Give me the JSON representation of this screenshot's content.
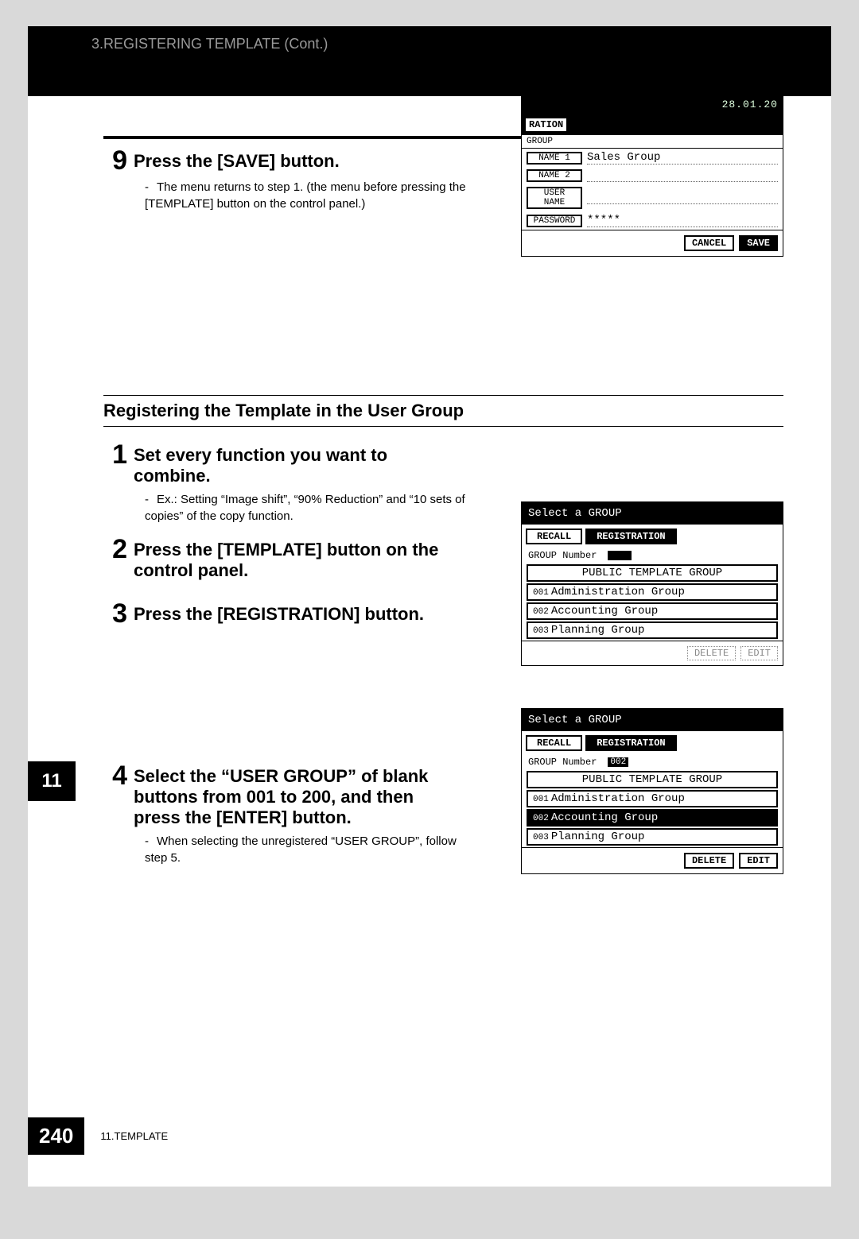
{
  "header": "3.REGISTERING TEMPLATE (Cont.)",
  "step9": {
    "num": "9",
    "title": "Press the [SAVE] button.",
    "bullet": "The menu returns to step 1. (the menu before pressing the [TEMPLATE] button on the control panel.)"
  },
  "panel1": {
    "date": "28.01.20",
    "tab": "RATION",
    "group_lbl": "GROUP",
    "fields": {
      "name1_lbl": "NAME 1",
      "name1_val": "Sales Group",
      "name2_lbl": "NAME 2",
      "name2_val": "",
      "user_lbl": "USER NAME",
      "user_val": "",
      "pass_lbl": "PASSWORD",
      "pass_val": "*****"
    },
    "cancel": "CANCEL",
    "save": "SAVE"
  },
  "section": "Registering the Template in the User Group",
  "step1": {
    "num": "1",
    "title": "Set every function you want to combine.",
    "bullet": "Ex.: Setting “Image shift”, “90% Reduction” and “10 sets of copies” of the copy function."
  },
  "step2": {
    "num": "2",
    "title": "Press the [TEMPLATE] button on the control panel."
  },
  "step3": {
    "num": "3",
    "title": "Press the [REGISTRATION] button."
  },
  "panel2": {
    "head": "Select a GROUP",
    "recall": "RECALL",
    "reg": "REGISTRATION",
    "gn_lbl": "GROUP Number",
    "gn_val": "",
    "public": "PUBLIC TEMPLATE GROUP",
    "g1_num": "001",
    "g1": "Administration Group",
    "g2_num": "002",
    "g2": "Accounting Group",
    "g3_num": "003",
    "g3": "Planning Group",
    "delete": "DELETE",
    "edit": "EDIT"
  },
  "step4": {
    "num": "4",
    "title": "Select the “USER GROUP” of blank buttons from 001 to 200, and then press the [ENTER] button.",
    "bullet": "When selecting the unregistered “USER GROUP”, follow step 5."
  },
  "panel3": {
    "head": "Select a GROUP",
    "recall": "RECALL",
    "reg": "REGISTRATION",
    "gn_lbl": "GROUP Number",
    "gn_val": "002",
    "public": "PUBLIC TEMPLATE GROUP",
    "g1_num": "001",
    "g1": "Administration Group",
    "g2_num": "002",
    "g2": "Accounting Group",
    "g3_num": "003",
    "g3": "Planning Group",
    "delete": "DELETE",
    "edit": "EDIT"
  },
  "chapter_tab": "11",
  "footer": {
    "page": "240",
    "text": "11.TEMPLATE"
  }
}
